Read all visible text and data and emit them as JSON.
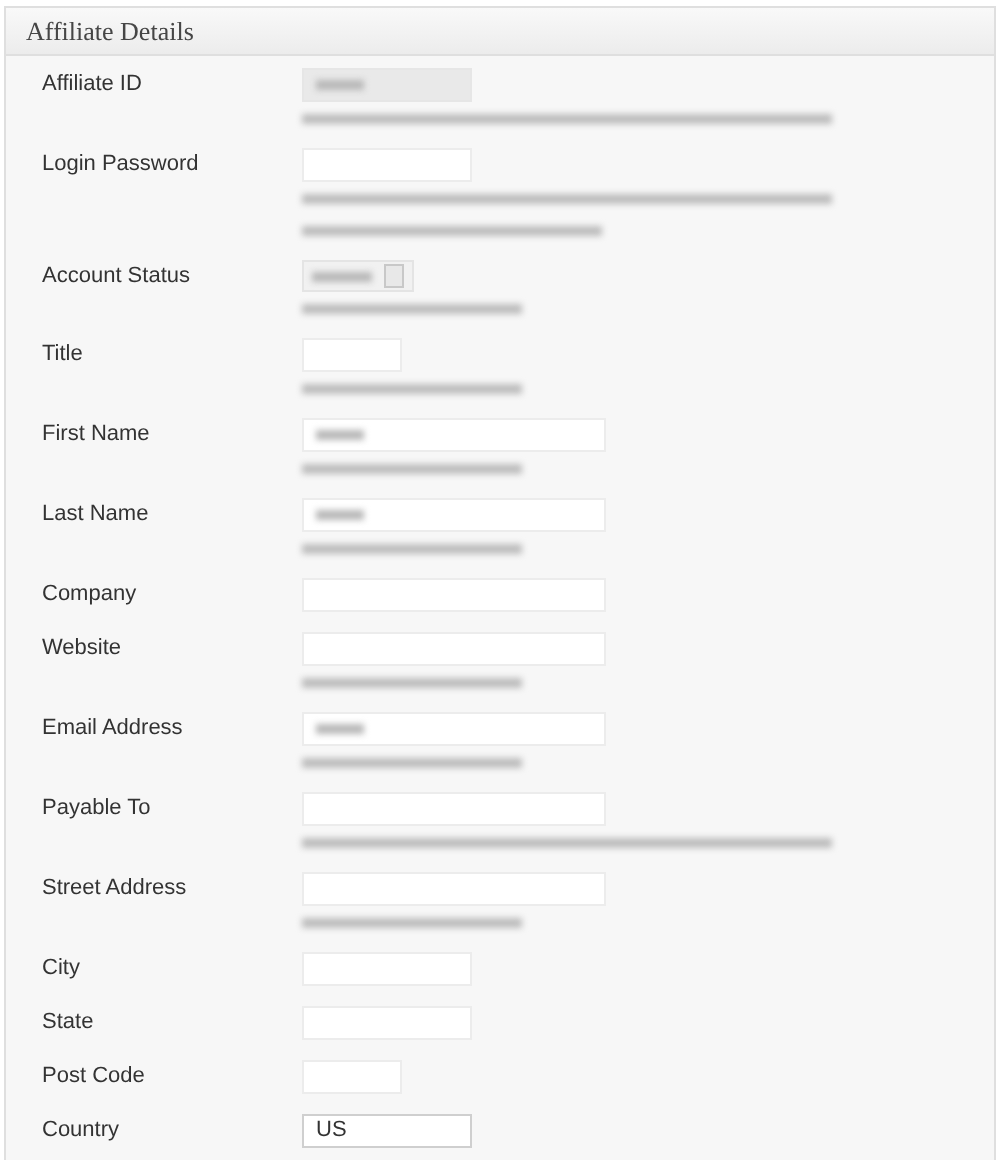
{
  "panel": {
    "title": "Affiliate Details"
  },
  "fields": [
    {
      "label": "Affiliate ID",
      "kind": "medium",
      "disabled": true,
      "value_blurred": true,
      "has_hint": true,
      "long_hint": true,
      "two_line_hint": false
    },
    {
      "label": "Login Password",
      "kind": "medium",
      "disabled": false,
      "value_blurred": false,
      "has_hint": true,
      "long_hint": true,
      "two_line_hint": true
    },
    {
      "label": "Account Status",
      "kind": "select",
      "disabled": false,
      "value_blurred": true,
      "has_hint": true,
      "long_hint": false,
      "two_line_hint": false
    },
    {
      "label": "Title",
      "kind": "small",
      "disabled": false,
      "value_blurred": false,
      "has_hint": true,
      "long_hint": false,
      "two_line_hint": false
    },
    {
      "label": "First Name",
      "kind": "wide",
      "disabled": false,
      "value_blurred": true,
      "has_hint": true,
      "long_hint": false,
      "two_line_hint": false
    },
    {
      "label": "Last Name",
      "kind": "wide",
      "disabled": false,
      "value_blurred": true,
      "has_hint": true,
      "long_hint": false,
      "two_line_hint": false
    },
    {
      "label": "Company",
      "kind": "wide",
      "disabled": false,
      "value_blurred": false,
      "has_hint": false
    },
    {
      "label": "Website",
      "kind": "wide",
      "disabled": false,
      "value_blurred": false,
      "has_hint": true,
      "long_hint": false,
      "two_line_hint": false
    },
    {
      "label": "Email Address",
      "kind": "wide",
      "disabled": false,
      "value_blurred": true,
      "has_hint": true,
      "long_hint": false,
      "two_line_hint": false
    },
    {
      "label": "Payable To",
      "kind": "wide",
      "disabled": false,
      "value_blurred": false,
      "has_hint": true,
      "long_hint": true,
      "two_line_hint": false
    },
    {
      "label": "Street Address",
      "kind": "wide",
      "disabled": false,
      "value_blurred": false,
      "has_hint": true,
      "long_hint": false,
      "two_line_hint": false
    },
    {
      "label": "City",
      "kind": "medium",
      "disabled": false,
      "value_blurred": false,
      "has_hint": false
    },
    {
      "label": "State",
      "kind": "medium",
      "disabled": false,
      "value_blurred": false,
      "has_hint": false
    },
    {
      "label": "Post Code",
      "kind": "small",
      "disabled": false,
      "value_blurred": false,
      "has_hint": false
    },
    {
      "label": "Country",
      "kind": "medium",
      "disabled": false,
      "value_blurred": false,
      "value": "US",
      "has_hint": false
    }
  ]
}
